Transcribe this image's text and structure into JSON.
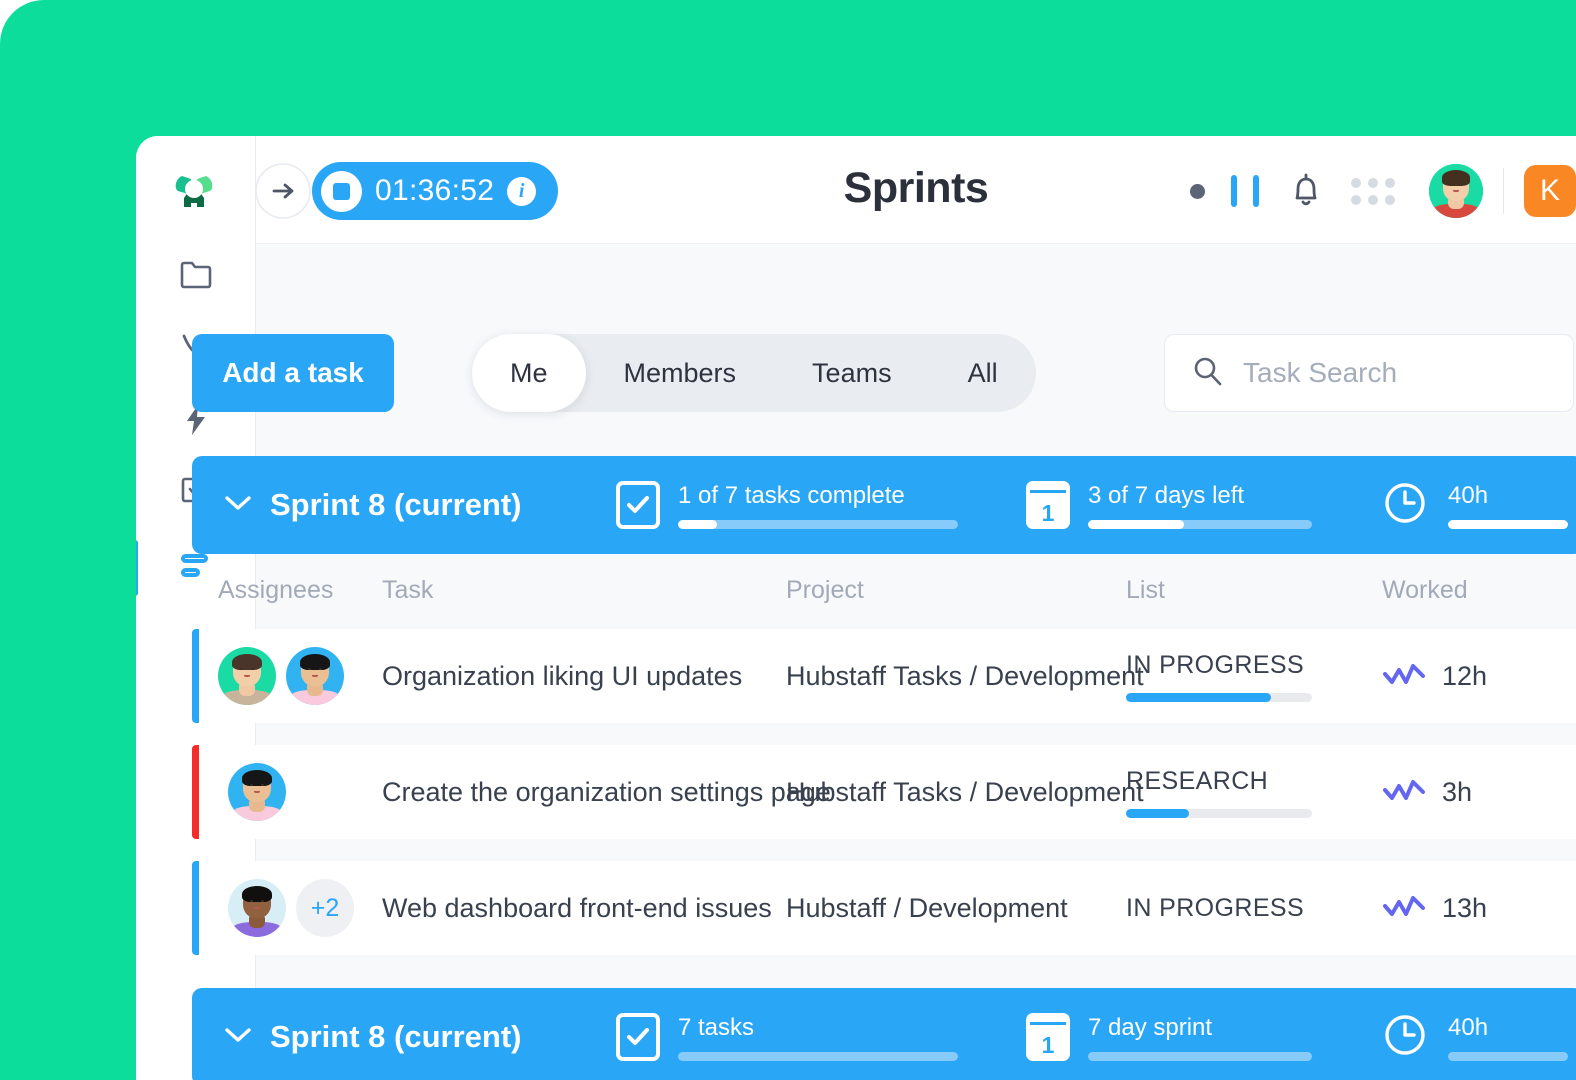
{
  "window": {
    "backdrop_color": "#0cdd9b",
    "accent_blue": "#2aa6f7",
    "panel_bg": "#f7f9fb"
  },
  "rail": {
    "logo_name": "hubstaff-logo",
    "items": [
      {
        "name": "projects",
        "icon": "folder-icon",
        "active": false
      },
      {
        "name": "insights",
        "icon": "curve-icon",
        "active": false
      },
      {
        "name": "automation",
        "icon": "lightning-icon",
        "active": false
      },
      {
        "name": "tasks",
        "icon": "checkbox-chat-icon",
        "active": false
      },
      {
        "name": "sprints",
        "icon": "sprints-bars-icon",
        "active": true
      }
    ],
    "expand_label": "→"
  },
  "topbar": {
    "timer": {
      "value": "01:36:52",
      "stop_label": "stop-timer",
      "info_label": "i"
    },
    "title": "Sprints",
    "actions": [
      {
        "name": "status-dot-icon"
      },
      {
        "name": "pause-icon"
      },
      {
        "name": "bell-icon"
      },
      {
        "name": "apps-grid-icon"
      }
    ],
    "user_avatar_name": "avatar-current-user",
    "org_badge": "K",
    "org_badge_color": "#f98724"
  },
  "toolbar": {
    "add_task_label": "Add a task",
    "tabs": [
      {
        "label": "Me",
        "active": true
      },
      {
        "label": "Members",
        "active": false
      },
      {
        "label": "Teams",
        "active": false
      },
      {
        "label": "All",
        "active": false
      }
    ],
    "search_placeholder": "Task Search",
    "search_value": ""
  },
  "table": {
    "columns": [
      "Assignees",
      "Task",
      "Project",
      "List",
      "Worked"
    ]
  },
  "sprints": [
    {
      "id": "sprint-bar-top",
      "title": "Sprint 8 (current)",
      "chevron": "chevron-down-icon",
      "stats": [
        {
          "icon": "check-square-icon",
          "label": "1 of 7 tasks complete",
          "progress": 14,
          "track_width": 280
        },
        {
          "icon": "calendar-icon",
          "calendar_day": "1",
          "label": "3 of 7 days left",
          "progress": 43,
          "track_width": 224
        },
        {
          "icon": "clock-icon",
          "label": "40h",
          "progress": 100,
          "track_width": 120
        }
      ]
    },
    {
      "id": "sprint-bar-bottom",
      "title": "Sprint 8 (current)",
      "chevron": "chevron-down-icon",
      "stats": [
        {
          "icon": "check-square-icon",
          "label": "7 tasks",
          "progress": 0,
          "track_width": 280
        },
        {
          "icon": "calendar-icon",
          "calendar_day": "1",
          "label": "7 day sprint",
          "progress": 0,
          "track_width": 224
        },
        {
          "icon": "clock-icon",
          "label": "40h",
          "progress": 0,
          "track_width": 120
        }
      ]
    }
  ],
  "rows": [
    {
      "flag_color": "#2aa6f7",
      "assignees": [
        {
          "name": "avatar-assignee-1",
          "bg": "#19dba3",
          "skin": "#f0c9a4",
          "hair": "#4a352a",
          "shirt": "#c8b49a"
        },
        {
          "name": "avatar-assignee-2",
          "bg": "#31b3f2",
          "skin": "#e8b98f",
          "hair": "#161616",
          "shirt": "#f9c9dc"
        }
      ],
      "extra": null,
      "task": "Organization liking UI updates",
      "project": "Hubstaff Tasks / Development",
      "list": "IN PROGRESS",
      "list_progress": 78,
      "has_list_bar": true,
      "worked": "12h"
    },
    {
      "flag_color": "#f62c2c",
      "assignees": [
        {
          "name": "avatar-assignee-3",
          "bg": "#31b3f2",
          "skin": "#e8b98f",
          "hair": "#161616",
          "shirt": "#f9c9dc"
        }
      ],
      "extra": null,
      "task": "Create the organization settings page",
      "project": "Hubstaff Tasks / Development",
      "list": "RESEARCH",
      "list_progress": 34,
      "has_list_bar": true,
      "worked": "3h"
    },
    {
      "flag_color": "#2aa6f7",
      "assignees": [
        {
          "name": "avatar-assignee-4",
          "bg": "#d8eef6",
          "skin": "#8a5a3b",
          "hair": "#12100f",
          "shirt": "#8b6bdd"
        }
      ],
      "extra": "+2",
      "task": "Web dashboard front-end issues",
      "project": "Hubstaff / Development",
      "list": "IN PROGRESS",
      "list_progress": 0,
      "has_list_bar": false,
      "worked": "13h"
    }
  ]
}
